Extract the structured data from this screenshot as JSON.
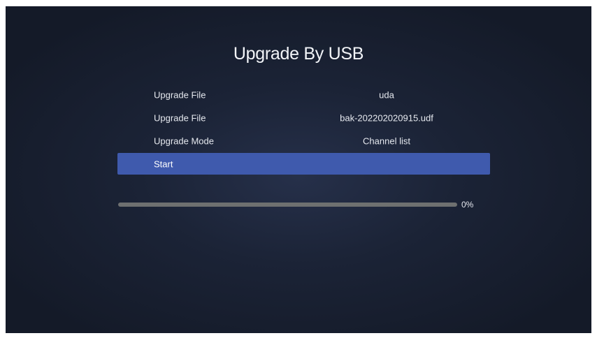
{
  "screen": {
    "title": "Upgrade By USB"
  },
  "menu": {
    "items": [
      {
        "label": "Upgrade File",
        "value": "uda"
      },
      {
        "label": "Upgrade File",
        "value": "bak-202202020915.udf"
      },
      {
        "label": "Upgrade Mode",
        "value": "Channel list"
      }
    ],
    "start_label": "Start"
  },
  "progress": {
    "percent": 0,
    "text": "0%"
  },
  "colors": {
    "highlight": "#3f5aad",
    "track": "#6e7070",
    "background": "#1b2336"
  }
}
